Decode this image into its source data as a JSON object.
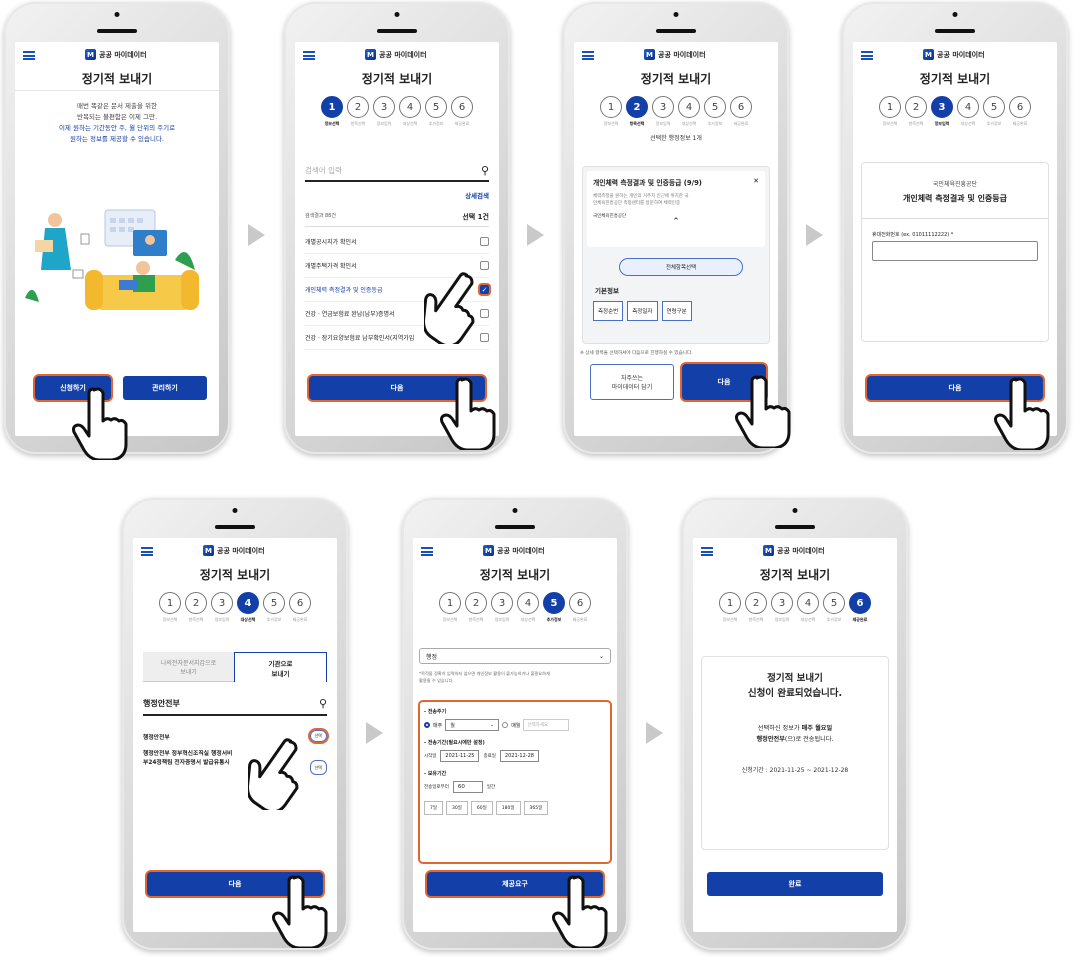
{
  "common": {
    "logo_text": "공공 마이데이터",
    "title": "정기적 보내기",
    "step_numbers": [
      "1",
      "2",
      "3",
      "4",
      "5",
      "6"
    ],
    "step_labels": [
      "정보선택",
      "항목선택",
      "정보입력",
      "대상선택",
      "추가정보",
      "제공완료"
    ],
    "next_label": "다음"
  },
  "screen1": {
    "desc_line1": "매번 똑같은 문서 제출을 위한",
    "desc_line2": "반복되는 불편함은 이제 그만.",
    "desc_line3": "이제 원하는 기간동안 주, 월 단위의 주기로",
    "desc_line4": "원하는 정보를 제공할 수 있습니다.",
    "apply_button": "신청하기",
    "manage_button": "관리하기"
  },
  "screen2": {
    "search_placeholder": "검색어 입력",
    "advanced_search": "상세검색",
    "result_count": "검색결과 88건",
    "selected_count": "선택 1건",
    "items": [
      "개별공시지가 확인서",
      "개별주택가격 확인서",
      "개인체력 측정결과 및 인증등급",
      "건강 · 연금보험료 완납(납부)증명서",
      "건강 · 장기요양보험료 납부확인서(지역가입"
    ]
  },
  "screen3": {
    "selected_info": "선택한 행정정보 1개",
    "card_title": "개인체력 측정결과 및 인증등급 (9/9)",
    "card_desc1": "체력측정을 원하는 개인의 거주지 인근에 위치한 국",
    "card_desc2": "민체육진흥공단 측정센터를 방문하여 체력인증",
    "card_org": "국민체육진흥공단",
    "select_all": "전체항목선택",
    "basic_info": "기본정보",
    "chips": [
      "측정순번",
      "측정일자",
      "연령구분"
    ],
    "notice": "※ 상세 항목을 선택하셔야 다음으로 진행하실 수 있습니다.",
    "save_button_line1": "자주쓰는",
    "save_button_line2": "마이데이터 담기"
  },
  "screen4": {
    "org": "국민체육진흥공단",
    "doc": "개인체력 측정결과 및 인증등급",
    "phone_label": "휴대전화번호 (ex. 01011112222) *"
  },
  "screen5": {
    "tab1_line1": "나의전자문서지갑으로",
    "tab1_line2": "보내기",
    "tab2_line1": "기관으로",
    "tab2_line2": "보내기",
    "search_value": "행정안전부",
    "org1": "행정안전부",
    "org2_line1": "행정안전부 정부혁신조직실 행정서비",
    "org2_line2": "부24정책팀 전자증명서 발급유통시",
    "select_label": "선택"
  },
  "screen6": {
    "dropdown": "행정",
    "notice_line1": "*목적을 정확히 입력하지 않으면 개인정보 활용이 불가능하거나 불필요하게",
    "notice_line2": "활용될 수 있습니다.",
    "period_title": "- 전송주기",
    "weekly": "매주",
    "weekday": "월",
    "monthly": "매월",
    "monthly_placeholder": "선택하세요",
    "range_title": "- 전송기간(필요시에만 설정)",
    "start_label": "시작일",
    "start_date": "2021-11-25",
    "end_label": "종료일",
    "end_date": "2021-12-28",
    "keep_title": "- 보유기간",
    "keep_label": "전송일로부터",
    "keep_value": "60",
    "keep_unit": "일간",
    "keep_options": [
      "7일",
      "30일",
      "60일",
      "180일",
      "365일"
    ],
    "submit": "제공요구"
  },
  "screen7": {
    "done_line1": "정기적 보내기",
    "done_line2": "신청이 완료되었습니다.",
    "msg_line1_a": "선택하신 정보가 ",
    "msg_line1_b": "매주 월요일",
    "msg_line2_a": "행정안전부",
    "msg_line2_b": "(으)로 전송됩니다.",
    "period": "신청기간 : 2021-11-25 ~ 2021-12-28",
    "finish": "완료"
  },
  "colors": {
    "primary": "#1340a8",
    "highlight": "#e3662f",
    "text": "#222222"
  }
}
